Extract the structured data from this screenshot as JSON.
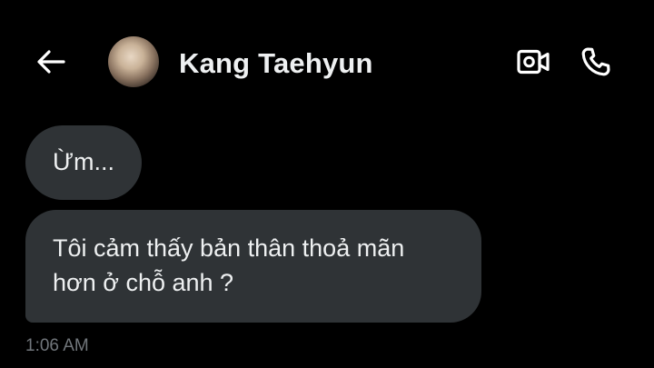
{
  "header": {
    "contact_name": "Kang Taehyun",
    "back_icon": "arrow-left-icon",
    "video_icon": "video-camera-icon",
    "call_icon": "phone-icon"
  },
  "messages": [
    {
      "text": "Ừm..."
    },
    {
      "text": "Tôi cảm thấy bản thân thoả mãn hơn ở chỗ anh ?"
    }
  ],
  "last_timestamp": "1:06 AM",
  "colors": {
    "background": "#000000",
    "bubble": "#2f3336",
    "text": "#eef0f1",
    "timestamp": "#71767b"
  }
}
